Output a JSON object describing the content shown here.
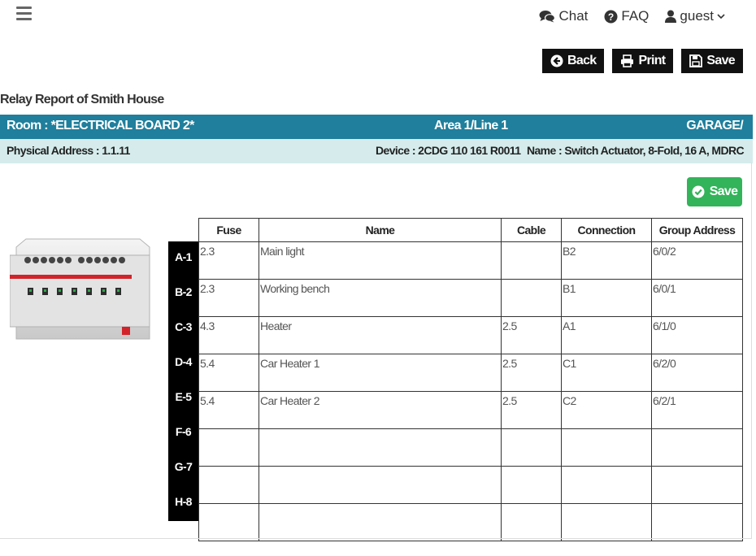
{
  "nav": {
    "chat": "Chat",
    "faq": "FAQ",
    "user": "guest"
  },
  "toolbar": {
    "back": "Back",
    "print": "Print",
    "save": "Save"
  },
  "report_title": "Relay Report of Smith House",
  "room_bar": {
    "room": "Room : *ELECTRICAL BOARD 2*",
    "area": "Area 1/Line 1",
    "location": "GARAGE/"
  },
  "info_bar": {
    "physical_address": "Physical Address : 1.1.11",
    "device": "Device : 2CDG 110 161 R0011",
    "name": "Name : Switch Actuator, 8-Fold, 16 A, MDRC"
  },
  "save_green": "Save",
  "table": {
    "headers": [
      "Fuse",
      "Name",
      "Cable",
      "Connection",
      "Group Address"
    ],
    "row_labels": [
      "A-1",
      "B-2",
      "C-3",
      "D-4",
      "E-5",
      "F-6",
      "G-7",
      "H-8"
    ],
    "rows": [
      [
        "2.3",
        "Main light",
        "",
        "B2",
        "6/0/2"
      ],
      [
        "2.3",
        "Working bench",
        "",
        "B1",
        "6/0/1"
      ],
      [
        "4.3",
        "Heater",
        "2.5",
        "A1",
        "6/1/0"
      ],
      [
        "5.4",
        "Car Heater 1",
        "2.5",
        "C1",
        "6/2/0"
      ],
      [
        "5.4",
        "Car Heater 2",
        "2.5",
        "C2",
        "6/2/1"
      ],
      [
        "",
        "",
        "",
        "",
        ""
      ],
      [
        "",
        "",
        "",
        "",
        ""
      ],
      [
        "",
        "",
        "",
        "",
        ""
      ]
    ]
  },
  "icons": [
    "menu-icon",
    "comments-icon",
    "question-circle-icon",
    "user-icon",
    "chevron-down-icon",
    "arrow-circle-left-icon",
    "print-icon",
    "floppy-icon",
    "check-circle-icon"
  ],
  "colors": {
    "room_bar": "#1f7f9c",
    "info_bar": "#d6ecec",
    "save_green": "#33b35a",
    "dark_button": "#111111"
  }
}
